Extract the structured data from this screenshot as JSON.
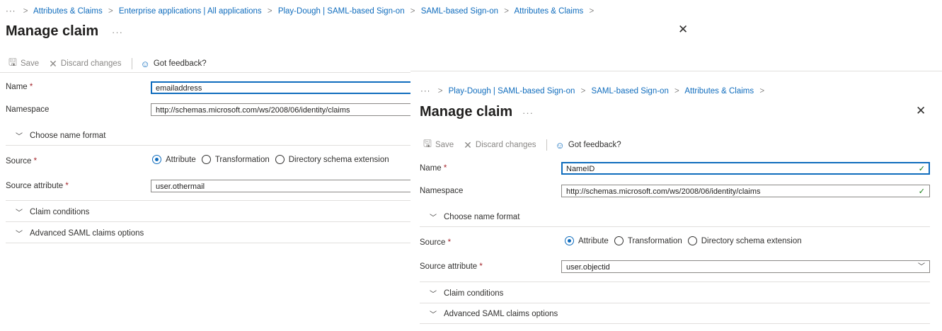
{
  "back": {
    "breadcrumb": [
      "Attributes & Claims",
      "Enterprise applications | All applications",
      "Play-Dough | SAML-based Sign-on",
      "SAML-based Sign-on",
      "Attributes & Claims"
    ],
    "title": "Manage claim",
    "toolbar": {
      "save": "Save",
      "discard": "Discard changes",
      "feedback": "Got feedback?"
    },
    "name_label": "Name",
    "name_value": "emailaddress",
    "namespace_label": "Namespace",
    "namespace_value": "http://schemas.microsoft.com/ws/2008/06/identity/claims",
    "choose_format": "Choose name format",
    "source_label": "Source",
    "source_options": [
      "Attribute",
      "Transformation",
      "Directory schema extension"
    ],
    "source_selected": "Attribute",
    "source_attr_label": "Source attribute",
    "source_attr_value": "user.othermail",
    "claim_conditions": "Claim conditions",
    "advanced": "Advanced SAML claims options"
  },
  "front": {
    "breadcrumb": [
      "Play-Dough | SAML-based Sign-on",
      "SAML-based Sign-on",
      "Attributes & Claims"
    ],
    "title": "Manage claim",
    "toolbar": {
      "save": "Save",
      "discard": "Discard changes",
      "feedback": "Got feedback?"
    },
    "name_label": "Name",
    "name_value": "NameID",
    "namespace_label": "Namespace",
    "namespace_value": "http://schemas.microsoft.com/ws/2008/06/identity/claims",
    "choose_format": "Choose name format",
    "source_label": "Source",
    "source_options": [
      "Attribute",
      "Transformation",
      "Directory schema extension"
    ],
    "source_selected": "Attribute",
    "source_attr_label": "Source attribute",
    "source_attr_value": "user.objectid",
    "claim_conditions": "Claim conditions",
    "advanced": "Advanced SAML claims options"
  },
  "symbols": {
    "ellipsis": "···",
    "required": "*"
  },
  "colors": {
    "accent": "#0f6cbd",
    "required": "#a4262c",
    "valid": "#107c10"
  }
}
